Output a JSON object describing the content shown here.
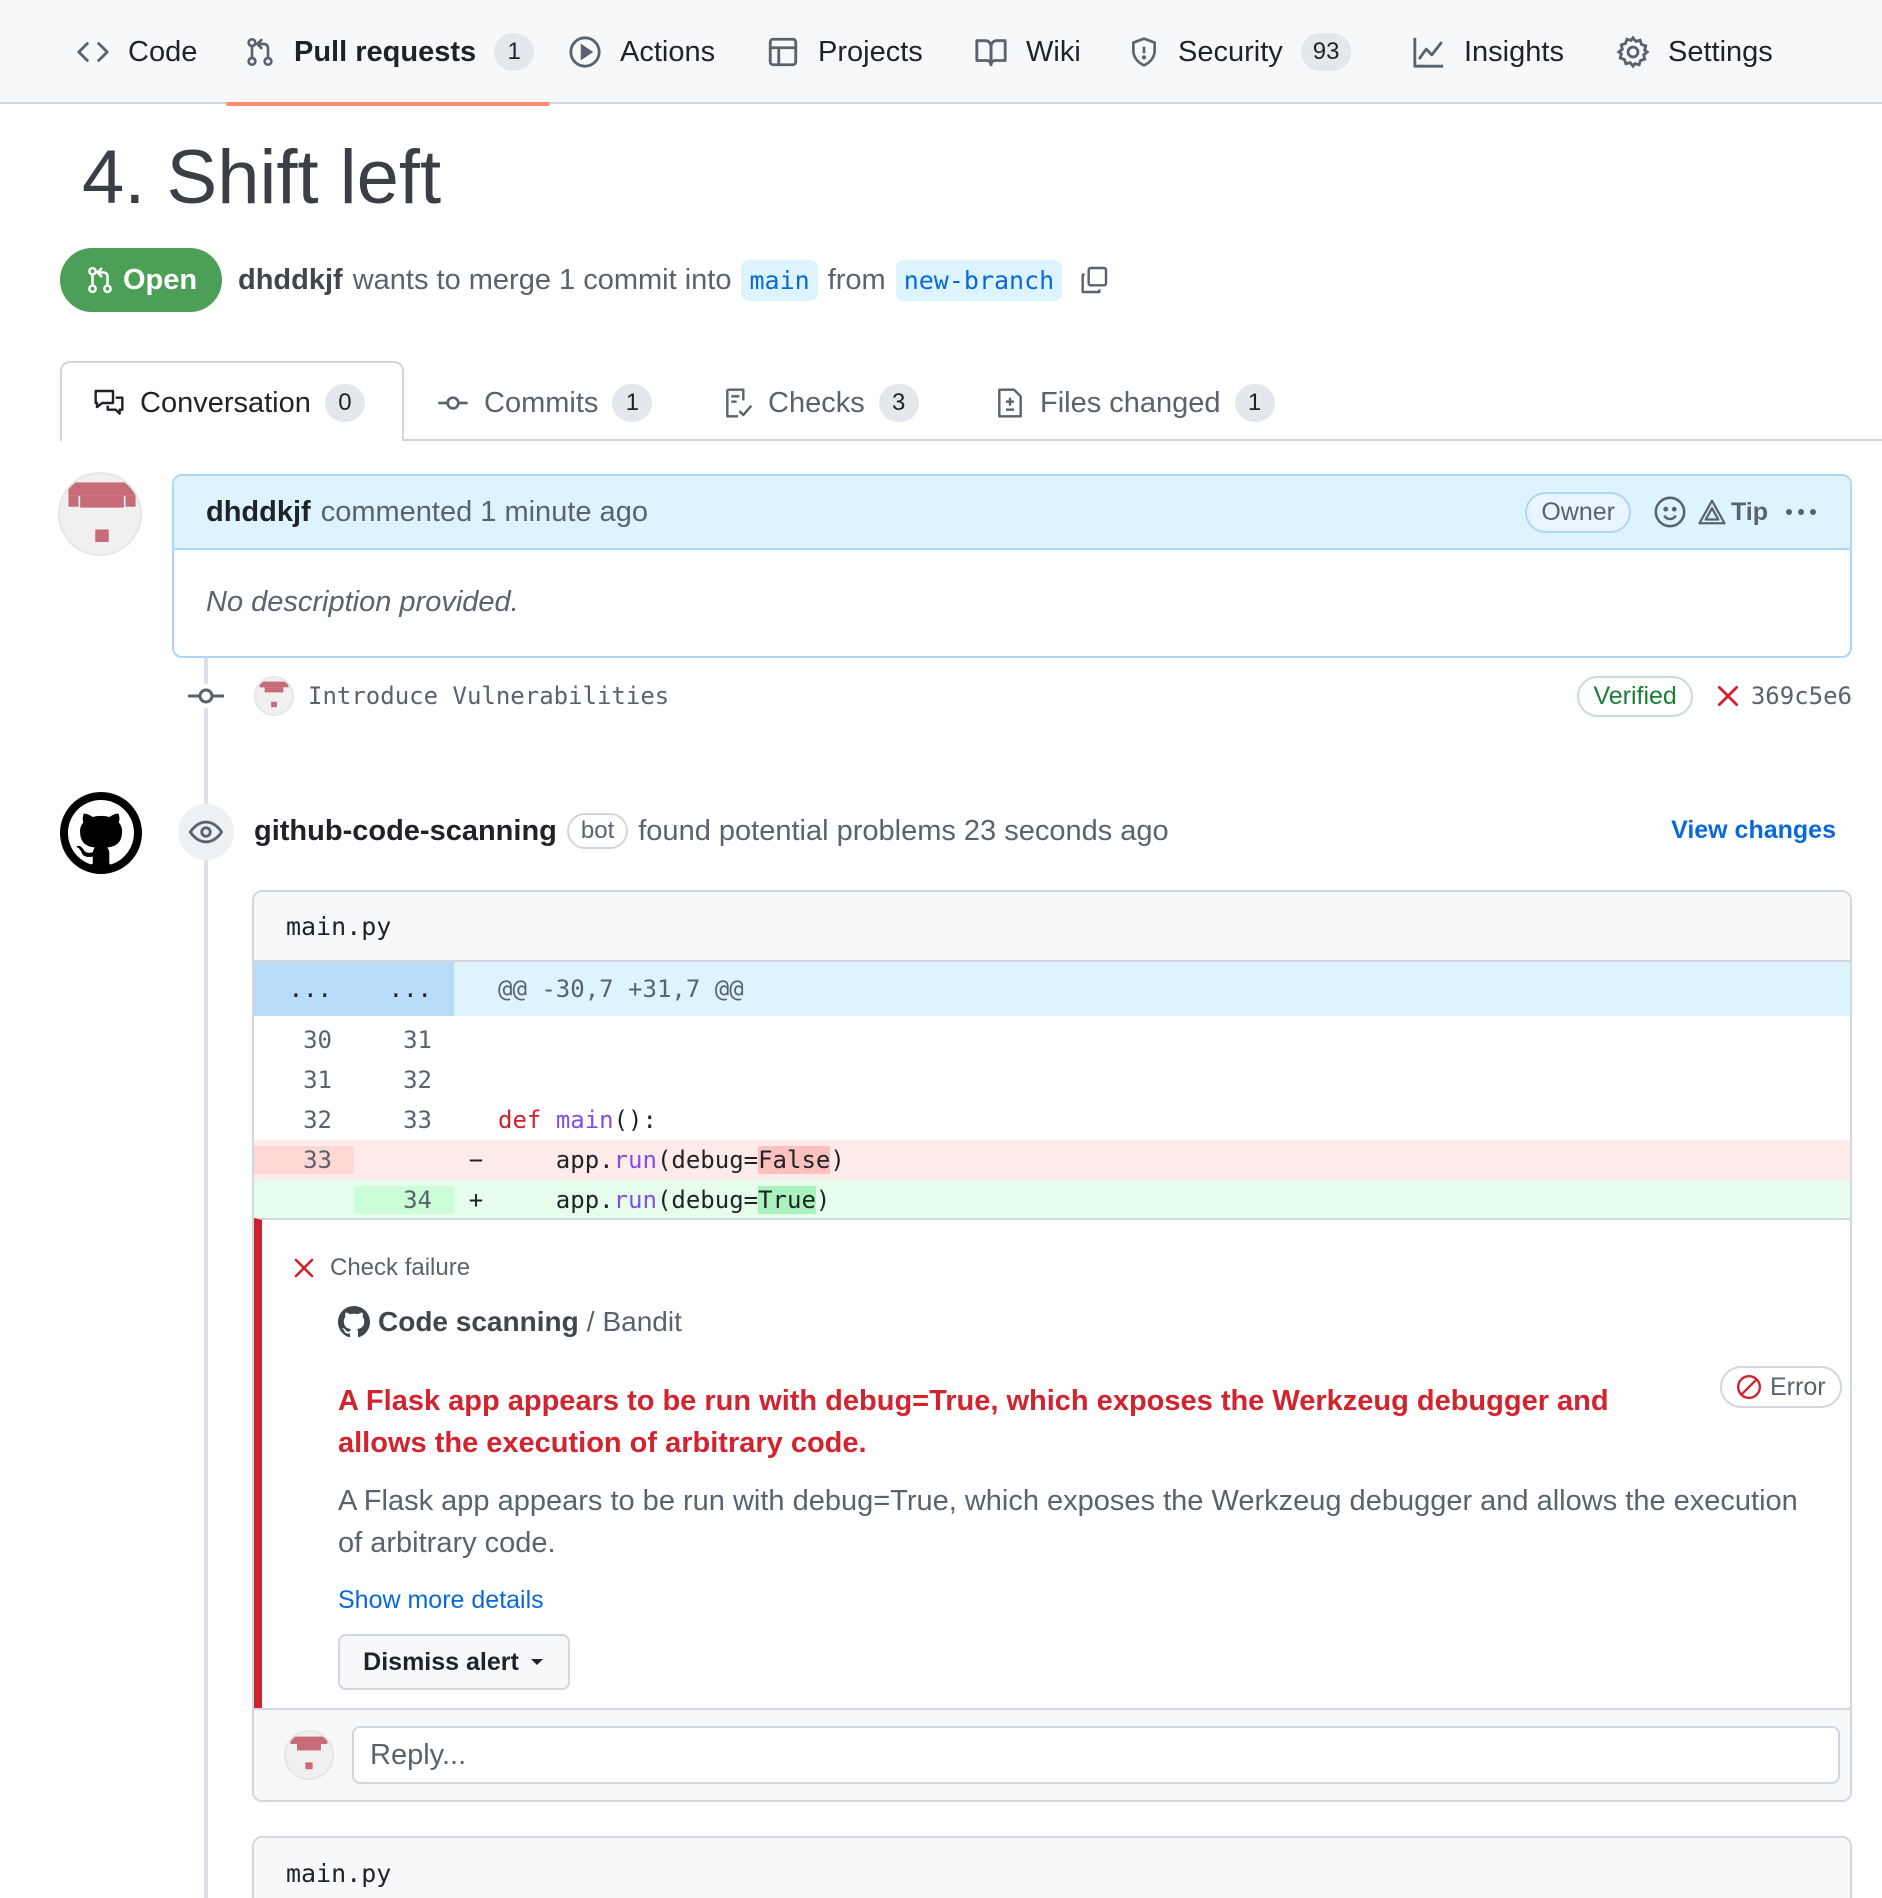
{
  "nav": {
    "code": "Code",
    "pull_requests": "Pull requests",
    "pull_requests_count": "1",
    "actions": "Actions",
    "projects": "Projects",
    "wiki": "Wiki",
    "security": "Security",
    "security_count": "93",
    "insights": "Insights",
    "settings": "Settings"
  },
  "pr": {
    "title": "4. Shift left",
    "state": "Open",
    "author": "dhddkjf",
    "merge_text": "wants to merge 1 commit into",
    "base_branch": "main",
    "from_text": "from",
    "head_branch": "new-branch"
  },
  "tabs": {
    "conversation": "Conversation",
    "conversation_count": "0",
    "commits": "Commits",
    "commits_count": "1",
    "checks": "Checks",
    "checks_count": "3",
    "files_changed": "Files changed",
    "files_changed_count": "1"
  },
  "comment": {
    "author": "dhddkjf",
    "action_text": "commented 1 minute ago",
    "owner_badge": "Owner",
    "tip_label": "Tip",
    "body": "No description provided."
  },
  "commit": {
    "message": "Introduce Vulnerabilities",
    "verified": "Verified",
    "sha": "369c5e6"
  },
  "review": {
    "author": "github-code-scanning",
    "bot_badge": "bot",
    "action_text": "found potential problems 23 seconds ago",
    "view_changes": "View changes",
    "file_name": "main.py",
    "hunk_header": "@@ -30,7 +31,7 @@",
    "hunk_dots_left": "...",
    "hunk_dots_right": "...",
    "lines": [
      {
        "old": "30",
        "new": "31"
      },
      {
        "old": "31",
        "new": "32"
      },
      {
        "old": "32",
        "new": "33",
        "kw": "def",
        "fn": "main",
        "rest": "():"
      },
      {
        "old": "33",
        "new": "",
        "sign": "−",
        "pre": "    app.",
        "fn": "run",
        "mid": "(debug=",
        "hl": "False",
        "post": ")"
      },
      {
        "old": "",
        "new": "34",
        "sign": "+",
        "pre": "    app.",
        "fn": "run",
        "mid": "(debug=",
        "hl": "True",
        "post": ")"
      }
    ],
    "alert": {
      "status": "Check failure",
      "tool": "Code scanning",
      "tool_sep": "/",
      "tool_name": "Bandit",
      "title": "A Flask app appears to be run with debug=True, which exposes the Werkzeug debugger and allows the execution of arbitrary code.",
      "severity": "Error",
      "description": "A Flask app appears to be run with debug=True, which exposes the Werkzeug debugger and allows the execution of arbitrary code.",
      "show_more": "Show more details",
      "dismiss": "Dismiss alert"
    },
    "reply_placeholder": "Reply..."
  },
  "second_file": {
    "file_name": "main.py"
  },
  "colors": {
    "open_green": "#4b9f57",
    "accent_blue": "#0969da",
    "danger_red": "#cf222e",
    "nav_underline": "#fd8c73"
  }
}
